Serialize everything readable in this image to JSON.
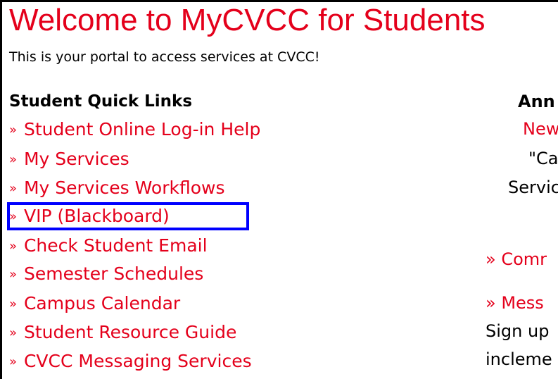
{
  "header": {
    "title": "Welcome to MyCVCC for Students",
    "subtitle": "This is your portal to access services at CVCC!"
  },
  "quick_links": {
    "heading": "Student Quick Links",
    "bullet": "»",
    "items": [
      {
        "label": "Student Online Log-in Help"
      },
      {
        "label": "My Services"
      },
      {
        "label": "My Services Workflows"
      },
      {
        "label": "VIP (Blackboard)"
      },
      {
        "label": "Check Student Email"
      },
      {
        "label": "Semester Schedules"
      },
      {
        "label": "Campus Calendar"
      },
      {
        "label": "Student Resource Guide"
      },
      {
        "label": "CVCC Messaging Services"
      }
    ],
    "highlighted_item": "VIP (Blackboard)",
    "highlight_color": "#0000ff"
  },
  "right_column": {
    "heading": "Ann",
    "link1": "New",
    "text1": "\"Ca",
    "text2": "Servic",
    "link2": "» Comr",
    "link3": "» Mess",
    "text3": "Sign up",
    "text4": "incleme"
  },
  "colors": {
    "brand_red": "#e4001b",
    "text": "#000000",
    "background": "#ffffff"
  }
}
